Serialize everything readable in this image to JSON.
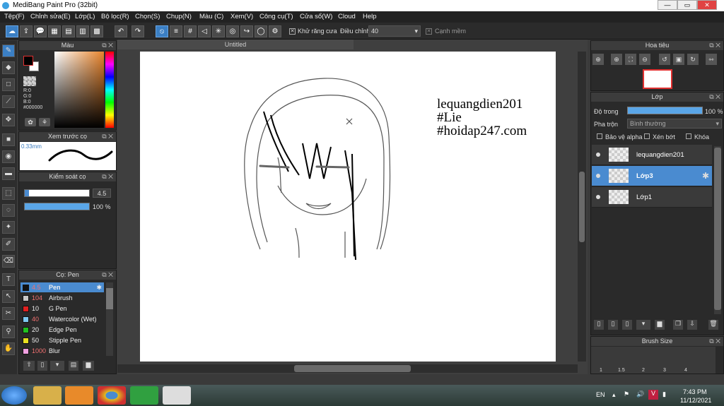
{
  "window": {
    "title": "MediBang Paint Pro (32bit)"
  },
  "menu": [
    "Tệp(F)",
    "Chỉnh sửa(E)",
    "Lớp(L)",
    "Bộ lọc(R)",
    "Chọn(S)",
    "Chụp(N)",
    "Màu (C)",
    "Xem(V)",
    "Công cụ(T)",
    "Cửa sổ(W)",
    "Cloud",
    "Help"
  ],
  "toolbar": {
    "antialias_label": "Khử răng cưa",
    "adjust_label": "Điều chỉnh",
    "adjust_value": "40",
    "soft_edge_label": "Cạnh mềm"
  },
  "color_panel": {
    "title": "Màu",
    "r": "R:0",
    "g": "G:0",
    "b": "B:0",
    "hex": "#000000"
  },
  "brush_preview": {
    "title": "Xem trước cọ",
    "size": "0.33mm"
  },
  "brush_control": {
    "title": "Kiểm soát cọ",
    "size": "4.5",
    "opacity": "100 %"
  },
  "brush_list": {
    "title": "Cọ: Pen",
    "items": [
      {
        "size": "4.5",
        "name": "Pen",
        "color": "#111111"
      },
      {
        "size": "104",
        "name": "Airbrush",
        "color": "#c8c8c8"
      },
      {
        "size": "10",
        "name": "G Pen",
        "color": "#e02020"
      },
      {
        "size": "40",
        "name": "Watercolor (Wet)",
        "color": "#7ec8f0"
      },
      {
        "size": "20",
        "name": "Edge Pen",
        "color": "#20c020"
      },
      {
        "size": "50",
        "name": "Stipple Pen",
        "color": "#e8e020"
      },
      {
        "size": "1000",
        "name": "Blur",
        "color": "#f0a0e0"
      }
    ]
  },
  "document": {
    "tab": "Untitled",
    "text_lines": [
      "lequangdien201",
      "#Lie",
      "#hoidap247.com"
    ]
  },
  "navigator": {
    "title": "Hoa tiêu"
  },
  "layer_panel": {
    "title": "Lớp",
    "opacity_label": "Độ trong",
    "opacity_value": "100 %",
    "blend_label": "Pha trộn",
    "blend_value": "Bình thường",
    "protect_alpha": "Bảo vệ alpha",
    "clip": "Xén bớt",
    "lock": "Khóa",
    "layers": [
      {
        "name": "lequangdien201"
      },
      {
        "name": "Lớp3"
      },
      {
        "name": "Lớp1"
      }
    ]
  },
  "brush_size": {
    "title": "Brush Size",
    "sizes": [
      "1",
      "1.5",
      "2",
      "3",
      "4"
    ]
  },
  "taskbar": {
    "lang": "EN",
    "time": "7:43 PM",
    "date": "11/12/2021"
  }
}
